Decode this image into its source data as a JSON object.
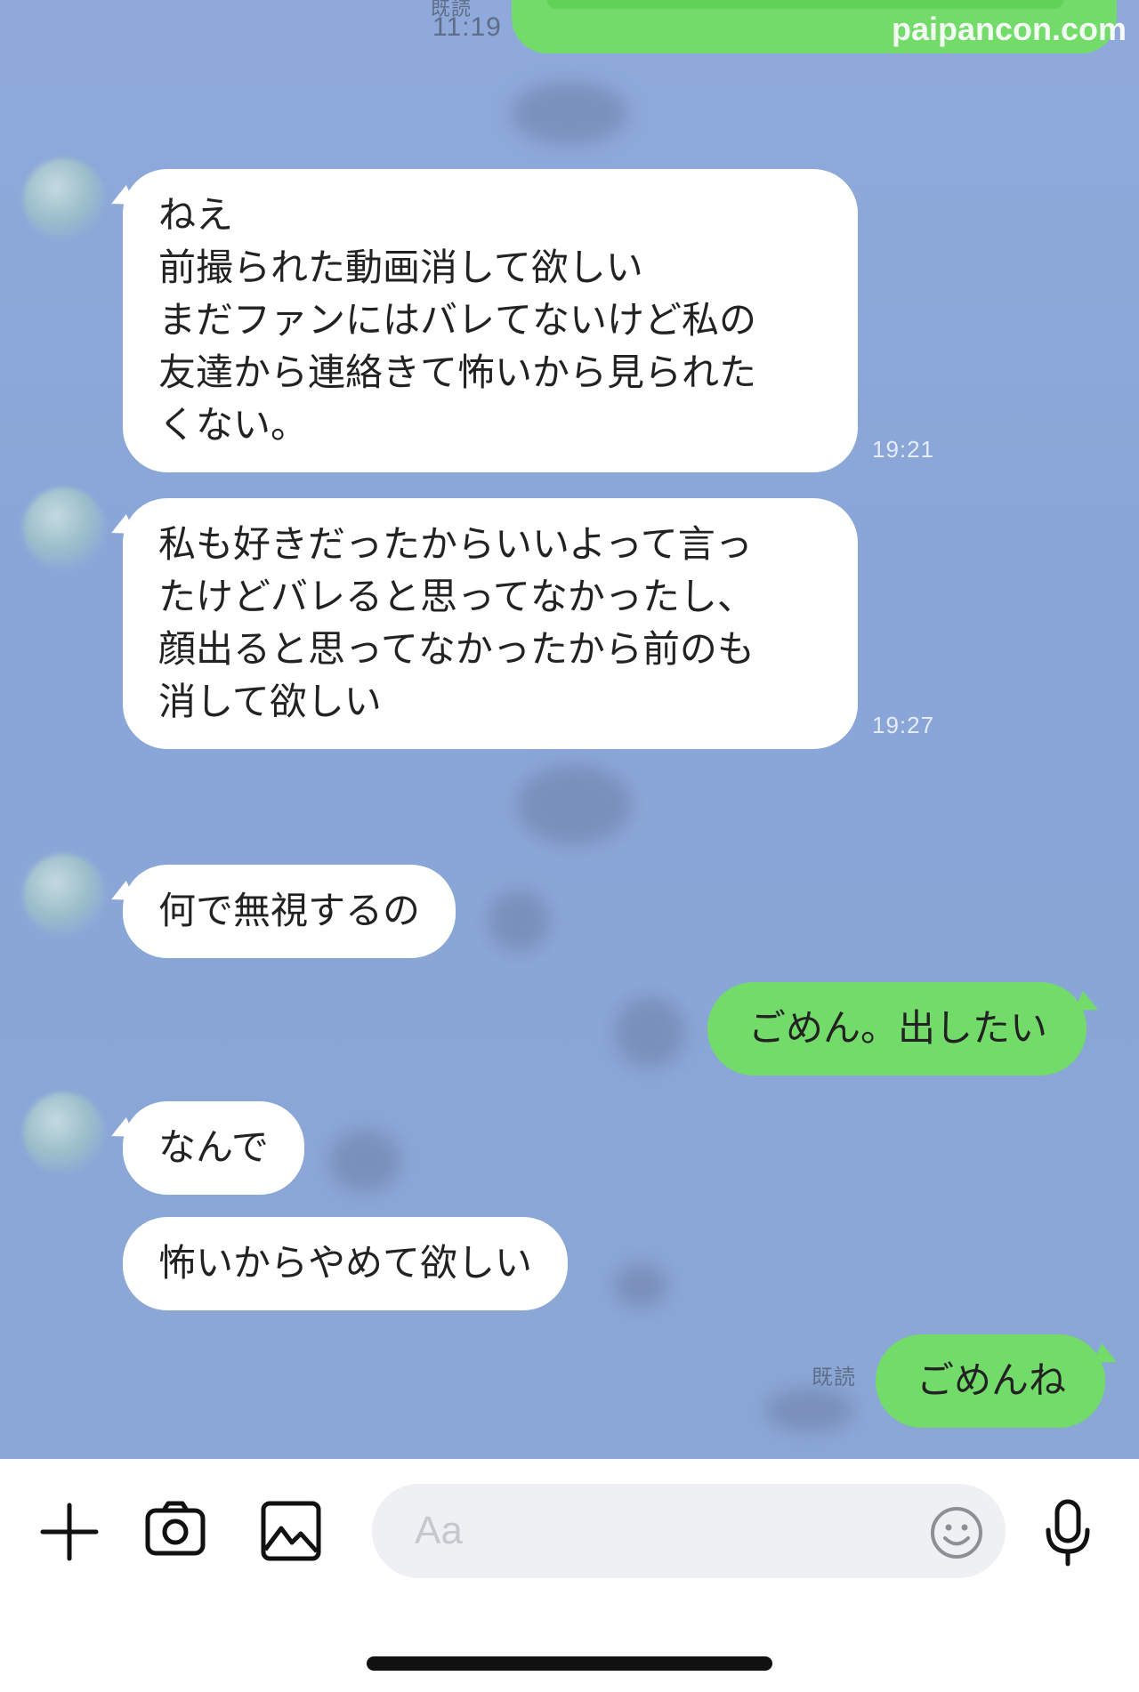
{
  "watermark": "paipancon.com",
  "colors": {
    "background": "#8aa6d8",
    "incoming_bubble": "#ffffff",
    "outgoing_bubble": "#72db69"
  },
  "top_message": {
    "read_label": "既読",
    "time": "11:19"
  },
  "messages": [
    {
      "side": "in",
      "text": "ねえ\n前撮られた動画消して欲しい\nまだファンにはバレてないけど私の\n友達から連絡きて怖いから見られた\nくない。",
      "time": "19:21"
    },
    {
      "side": "in",
      "text": "私も好きだったからいいよって言っ\nたけどバレると思ってなかったし、\n顔出ると思ってなかったから前のも\n消して欲しい",
      "time": "19:27"
    },
    {
      "side": "in",
      "text": "何で無視するの"
    },
    {
      "side": "out",
      "text": "ごめん。出したい"
    },
    {
      "side": "in",
      "text": "なんで"
    },
    {
      "side": "in",
      "text": "怖いからやめて欲しい"
    },
    {
      "side": "out",
      "text": "ごめんね",
      "read_label": "既読"
    }
  ],
  "input_bar": {
    "placeholder": "Aa",
    "icons": [
      "plus-icon",
      "camera-icon",
      "image-icon",
      "emoji-icon",
      "microphone-icon"
    ]
  }
}
